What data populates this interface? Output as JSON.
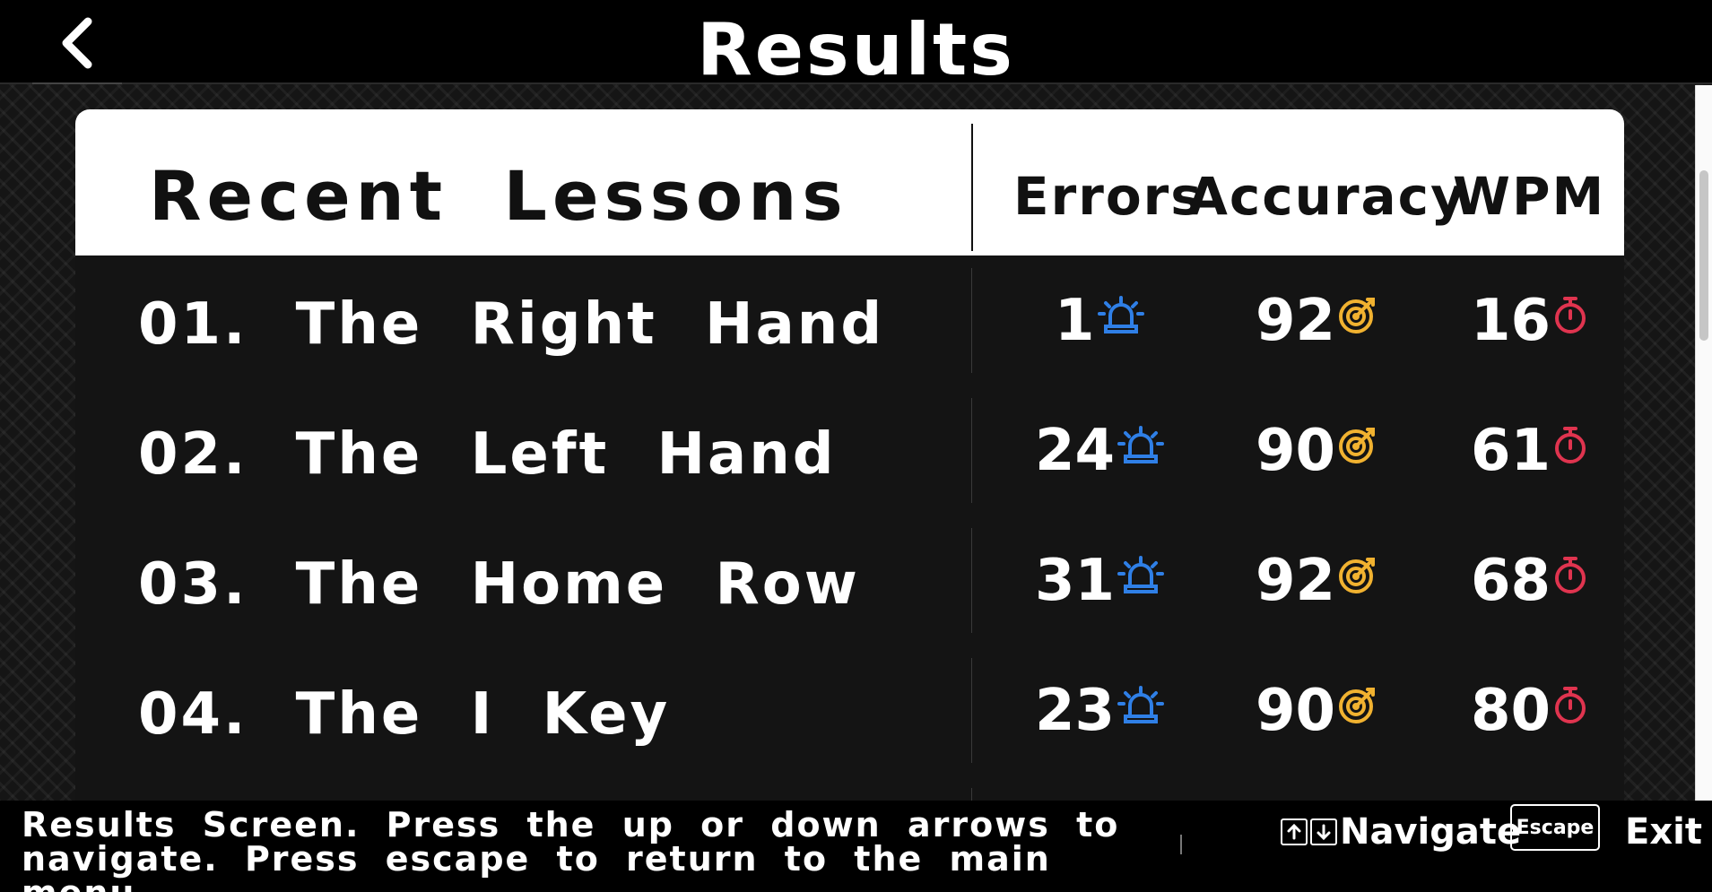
{
  "header": {
    "title": "Results",
    "back_icon": "chevron-left-icon"
  },
  "table": {
    "heading": "Recent Lessons",
    "columns": [
      "Errors",
      "Accuracy",
      "WPM"
    ],
    "rows": [
      {
        "label": "01. The Right Hand",
        "errors": "1",
        "accuracy": "92",
        "wpm": "16"
      },
      {
        "label": "02. The Left Hand",
        "errors": "24",
        "accuracy": "90",
        "wpm": "61"
      },
      {
        "label": "03. The Home Row",
        "errors": "31",
        "accuracy": "92",
        "wpm": "68"
      },
      {
        "label": "04. The I Key",
        "errors": "23",
        "accuracy": "90",
        "wpm": "80"
      }
    ],
    "icons": {
      "errors": "siren-icon",
      "accuracy": "target-icon",
      "wpm": "stopwatch-icon"
    }
  },
  "status_bar": {
    "text": "Results Screen. Press the up or down arrows to navigate. Press escape to return to the main menu.",
    "navigate_label": "Navigate",
    "escape_key_label": "Escape",
    "exit_label": "Exit"
  },
  "colors": {
    "background": "#151515",
    "header_background": "#ffffff",
    "errors_icon": "#2f7fe6",
    "accuracy_icon": "#f1b230",
    "wpm_icon": "#e0344f"
  }
}
